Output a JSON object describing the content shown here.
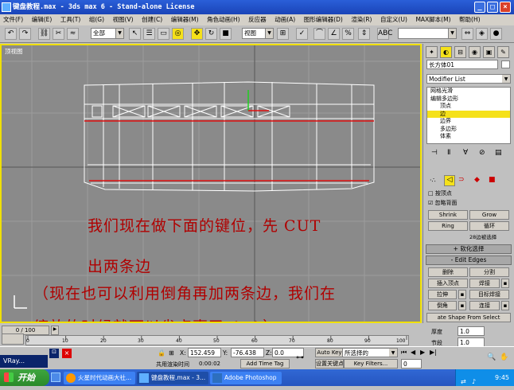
{
  "window": {
    "title": "键盘教程.max - 3ds max 6 - Stand-alone License"
  },
  "menu": [
    "文件(F)",
    "编辑(E)",
    "工具(T)",
    "组(G)",
    "视图(V)",
    "创建(C)",
    "编辑器(M)",
    "角色动画(H)",
    "反应器",
    "动画(A)",
    "图形编辑器(D)",
    "渲染(R)",
    "自定义(U)",
    "MAX脚本(M)",
    "帮助(H)"
  ],
  "toolbar": {
    "selection_filter": "全部",
    "ref_coord": "视图"
  },
  "viewport": {
    "label": "顶视图"
  },
  "overlay": {
    "line1": "我们现在做下面的键位，先 CUT",
    "line2": "出两条边",
    "line3": "（现在也可以利用倒角再加两条边，我们在",
    "line4": "缩放的时候就可以省点事了 ^-^）"
  },
  "panel": {
    "object_name": "长方体01",
    "modifier_list": "Modifier List",
    "stack": [
      "网格光滑",
      "编辑多边形",
      "顶点",
      "边",
      "边界",
      "多边形",
      "体素"
    ],
    "by_vertex": "按顶点",
    "ignore_backfacing": "忽略背面",
    "shrink": "Shrink",
    "grow": "Grow",
    "ring": "Ring",
    "loop": "循环",
    "edges_selected": "28边被选择",
    "soft_selection": "软化选择",
    "edit_edges": "Edit Edges",
    "remove": "删除",
    "split": "分割",
    "insert_vertex": "插入顶点",
    "weld": "焊接",
    "extrude": "拉伸",
    "target_weld": "目标焊接",
    "chamfer": "倒角",
    "connect": "连接",
    "create_shape": "ate Shape From Select",
    "thickness_label": "厚度",
    "thickness": "1.0",
    "seg_label": "节段",
    "seg": "1.0"
  },
  "timeline": {
    "frame": "0 / 100",
    "ticks": [
      "0",
      "10",
      "20",
      "30",
      "40",
      "50",
      "60",
      "70",
      "80",
      "90",
      "100"
    ]
  },
  "status": {
    "x_label": "X:",
    "x": "152.459",
    "y_label": "Y:",
    "y": "-76.438",
    "z_label": "Z:",
    "z": "0.0",
    "auto_key": "Auto Key",
    "set_key": "设置关键点",
    "selected_combo": "所选择的",
    "key_filters": "Key Filters...",
    "render_time_label": "共用渲染时间",
    "render_time": "0:00:02",
    "add_time_tag": "Add Time Tag",
    "frame_field": "0"
  },
  "taskbar": {
    "start": "开始",
    "vray": "VRay...",
    "items": [
      "火星时代动画大社...",
      "键盘教程.max - 3...",
      "Adobe Photoshop"
    ],
    "clock": "9:45"
  }
}
